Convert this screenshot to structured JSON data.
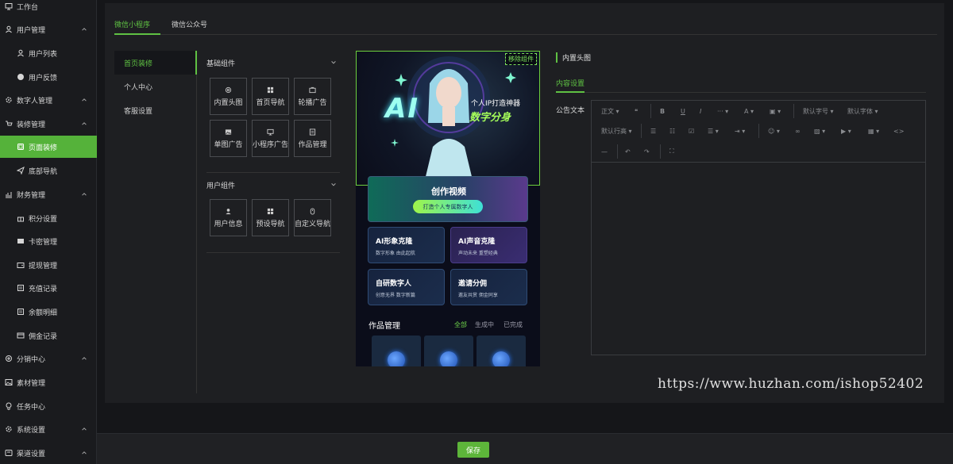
{
  "sidebar": {
    "items": [
      {
        "label": "工作台",
        "icon": "monitor-icon",
        "type": "top"
      },
      {
        "label": "用户管理",
        "icon": "user-icon",
        "type": "group"
      },
      {
        "label": "用户列表",
        "icon": "user-icon",
        "type": "sub"
      },
      {
        "label": "用户反馈",
        "icon": "question-icon",
        "type": "sub"
      },
      {
        "label": "数字人管理",
        "icon": "gear-icon",
        "type": "group"
      },
      {
        "label": "装修管理",
        "icon": "cart-icon",
        "type": "group"
      },
      {
        "label": "页面装修",
        "icon": "page-icon",
        "type": "sub",
        "active": true
      },
      {
        "label": "底部导航",
        "icon": "send-icon",
        "type": "sub"
      },
      {
        "label": "财务管理",
        "icon": "chart-icon",
        "type": "group"
      },
      {
        "label": "积分设置",
        "icon": "gift-icon",
        "type": "sub"
      },
      {
        "label": "卡密管理",
        "icon": "card-icon",
        "type": "sub"
      },
      {
        "label": "提现管理",
        "icon": "wallet-icon",
        "type": "sub"
      },
      {
        "label": "充值记录",
        "icon": "list-icon",
        "type": "sub"
      },
      {
        "label": "余额明细",
        "icon": "list-icon",
        "type": "sub"
      },
      {
        "label": "佣金记录",
        "icon": "coin-icon",
        "type": "sub"
      },
      {
        "label": "分销中心",
        "icon": "share-icon",
        "type": "group"
      },
      {
        "label": "素材管理",
        "icon": "image-icon",
        "type": "top"
      },
      {
        "label": "任务中心",
        "icon": "task-icon",
        "type": "top"
      },
      {
        "label": "系统设置",
        "icon": "gear-icon",
        "type": "group"
      },
      {
        "label": "渠道设置",
        "icon": "channel-icon",
        "type": "group"
      }
    ]
  },
  "tabs": [
    "微信小程序",
    "微信公众号"
  ],
  "submenu": [
    "首页装修",
    "个人中心",
    "客服设置"
  ],
  "groups": {
    "basic": {
      "title": "基础组件",
      "items": [
        {
          "label": "内置头图",
          "icon": "target-icon"
        },
        {
          "label": "首页导航",
          "icon": "grid-icon"
        },
        {
          "label": "轮播广告",
          "icon": "carousel-icon"
        },
        {
          "label": "单图广告",
          "icon": "image-icon"
        },
        {
          "label": "小程序广告",
          "icon": "screen-icon"
        },
        {
          "label": "作品管理",
          "icon": "doc-icon"
        }
      ]
    },
    "user": {
      "title": "用户组件",
      "items": [
        {
          "label": "用户信息",
          "icon": "user-icon"
        },
        {
          "label": "预设导航",
          "icon": "grid-icon"
        },
        {
          "label": "自定义导航",
          "icon": "mouse-icon"
        }
      ]
    }
  },
  "preview": {
    "remove_label": "移除组件",
    "hero_ai": "AI",
    "hero_sub1": "个人IP打造神器",
    "hero_sub2": "数字分身",
    "cta_title": "创作视频",
    "cta_pill": "打造个人专属数字人",
    "features": [
      {
        "title": "AI形象克隆",
        "sub": "数字形象 由此起航"
      },
      {
        "title": "AI声音克隆",
        "sub": "声动未来 重塑经典"
      },
      {
        "title": "自研数字人",
        "sub": "创意无界 数字新篇"
      },
      {
        "title": "邀请分佣",
        "sub": "邀友共赏 佣金同享"
      }
    ],
    "works_title": "作品管理",
    "works_tabs": [
      "全部",
      "生成中",
      "已完成"
    ]
  },
  "settings": {
    "title": "内置头图",
    "tab": "内容设置",
    "field_label": "公告文本",
    "toolbar": {
      "text_style": "正文",
      "font_size": "默认字号",
      "font_family": "默认字体",
      "line_height": "默认行高",
      "more": "···",
      "font_color": "A",
      "code": "<>"
    }
  },
  "footer": {
    "save_label": "保存"
  },
  "watermark": "https://www.huzhan.com/ishop52402",
  "colors": {
    "accent": "#5fc143",
    "active_bg": "#55b23a"
  }
}
